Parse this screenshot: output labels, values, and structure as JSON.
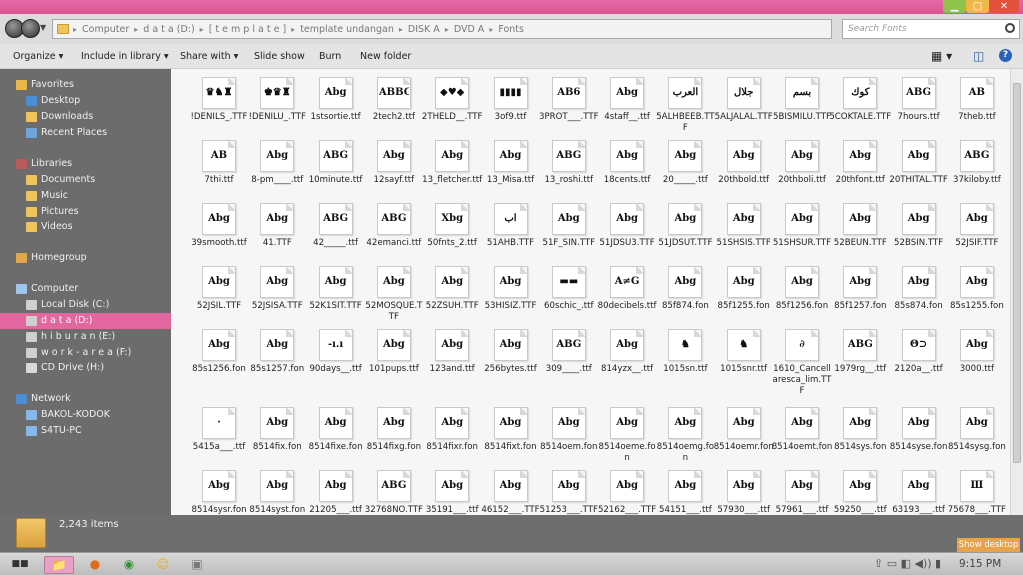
{
  "window": {
    "minimize": "▁",
    "maximize": "□",
    "close": "✕"
  },
  "address": {
    "segments": [
      "Computer",
      "d a t a (D:)",
      "[ t e m p l a t e ]",
      "template undangan",
      "DISK A",
      "DVD A",
      "Fonts"
    ],
    "search_placeholder": "Search Fonts"
  },
  "toolbar": {
    "organize": "Organize",
    "include": "Include in library",
    "share": "Share with",
    "slideshow": "Slide show",
    "burn": "Burn",
    "newfolder": "New folder"
  },
  "nav": [
    {
      "label": "Favorites",
      "icon": "star-icon",
      "kind": "header"
    },
    {
      "label": "Desktop",
      "icon": "desktop-icon"
    },
    {
      "label": "Downloads",
      "icon": "folder-icon"
    },
    {
      "label": "Recent Places",
      "icon": "recent-icon"
    },
    {
      "label": "Libraries",
      "icon": "libraries-icon",
      "kind": "header"
    },
    {
      "label": "Documents",
      "icon": "folder-icon"
    },
    {
      "label": "Music",
      "icon": "folder-icon"
    },
    {
      "label": "Pictures",
      "icon": "folder-icon"
    },
    {
      "label": "Videos",
      "icon": "folder-icon"
    },
    {
      "label": "Homegroup",
      "icon": "homegroup-icon",
      "kind": "header"
    },
    {
      "label": "Computer",
      "icon": "computer-icon",
      "kind": "header"
    },
    {
      "label": "Local Disk (C:)",
      "icon": "drive-icon"
    },
    {
      "label": "d a t a (D:)",
      "icon": "drive-icon",
      "selected": true
    },
    {
      "label": "h i b u r a n (E:)",
      "icon": "drive-icon"
    },
    {
      "label": "w o r k - a r e a (F:)",
      "icon": "drive-icon"
    },
    {
      "label": "CD Drive (H:)",
      "icon": "cd-icon"
    },
    {
      "label": "Network",
      "icon": "network-icon",
      "kind": "header"
    },
    {
      "label": "BAKOL-KODOK",
      "icon": "pc-icon"
    },
    {
      "label": "S4TU-PC",
      "icon": "pc-icon"
    }
  ],
  "files": [
    {
      "name": "!DENILS_.TTF",
      "g": "♛♞♜"
    },
    {
      "name": "!DENILU_.TTF",
      "g": "♚♛♜"
    },
    {
      "name": "1stsortie.ttf",
      "g": "Abg"
    },
    {
      "name": "2tech2.ttf",
      "g": "ABBG"
    },
    {
      "name": "2THELD__.TTF",
      "g": "◆♥◆"
    },
    {
      "name": "3of9.ttf",
      "g": "▮▮▮▮"
    },
    {
      "name": "3PROT___.TTF",
      "g": "AB6"
    },
    {
      "name": "4staff__.ttf",
      "g": "Abg"
    },
    {
      "name": "5ALHBEEB.TTF",
      "g": "ﺍﻟﻌﺮﺏ"
    },
    {
      "name": "5ALJALAL.TTF",
      "g": "ﺟﻼﻝ"
    },
    {
      "name": "5BISMILU.TTF",
      "g": "ﺑﺴﻢ"
    },
    {
      "name": "5COKTALE.TTF",
      "g": "ﻛﻮﻙ"
    },
    {
      "name": "7hours.ttf",
      "g": "ABG"
    },
    {
      "name": "7theb.ttf",
      "g": "AB"
    },
    {
      "name": "7thi.ttf",
      "g": "AB"
    },
    {
      "name": "8-pm____.ttf",
      "g": "Abg"
    },
    {
      "name": "10minute.ttf",
      "g": "ABG"
    },
    {
      "name": "12sayf.ttf",
      "g": "Abg"
    },
    {
      "name": "13_fletcher.ttf",
      "g": "Abg"
    },
    {
      "name": "13_Misa.ttf",
      "g": "Abg"
    },
    {
      "name": "13_roshi.ttf",
      "g": "ABG"
    },
    {
      "name": "18cents.ttf",
      "g": "Abg"
    },
    {
      "name": "20_____.ttf",
      "g": "Abg"
    },
    {
      "name": "20thbold.ttf",
      "g": "Abg"
    },
    {
      "name": "20thboli.ttf",
      "g": "Abg"
    },
    {
      "name": "20thfont.ttf",
      "g": "Abg"
    },
    {
      "name": "20THITAL.TTF",
      "g": "Abg"
    },
    {
      "name": "37kiloby.ttf",
      "g": "ABG"
    },
    {
      "name": "39smooth.ttf",
      "g": "Abg"
    },
    {
      "name": "41.TTF",
      "g": "Abg"
    },
    {
      "name": "42_____.ttf",
      "g": "ABG"
    },
    {
      "name": "42emanci.ttf",
      "g": "ABG"
    },
    {
      "name": "50fnts_2.ttf",
      "g": "Xbg"
    },
    {
      "name": "51AHB.TTF",
      "g": "ﺍﺏ"
    },
    {
      "name": "51F_SIN.TTF",
      "g": "Abg"
    },
    {
      "name": "51JDSU3.TTF",
      "g": "Abg"
    },
    {
      "name": "51JDSUT.TTF",
      "g": "Abg"
    },
    {
      "name": "51SHSIS.TTF",
      "g": "Abg"
    },
    {
      "name": "51SHSUR.TTF",
      "g": "Abg"
    },
    {
      "name": "52BEUN.TTF",
      "g": "Abg"
    },
    {
      "name": "52BSIN.TTF",
      "g": "Abg"
    },
    {
      "name": "52JSIF.TTF",
      "g": "Abg"
    },
    {
      "name": "52JSIL.TTF",
      "g": "Abg"
    },
    {
      "name": "52JSISA.TTF",
      "g": "Abg"
    },
    {
      "name": "52K1SIT.TTF",
      "g": "Abg"
    },
    {
      "name": "52MOSQUE.TTF",
      "g": "Abg"
    },
    {
      "name": "52ZSUH.TTF",
      "g": "Abg"
    },
    {
      "name": "53HISIZ.TTF",
      "g": "Abg"
    },
    {
      "name": "60schic_.ttf",
      "g": "▬▬"
    },
    {
      "name": "80decibels.ttf",
      "g": "A≠G"
    },
    {
      "name": "85f874.fon",
      "g": "Abg"
    },
    {
      "name": "85f1255.fon",
      "g": "Abg"
    },
    {
      "name": "85f1256.fon",
      "g": "Abg"
    },
    {
      "name": "85f1257.fon",
      "g": "Abg"
    },
    {
      "name": "85s874.fon",
      "g": "Abg"
    },
    {
      "name": "85s1255.fon",
      "g": "Abg"
    },
    {
      "name": "85s1256.fon",
      "g": "Abg"
    },
    {
      "name": "85s1257.fon",
      "g": "Abg"
    },
    {
      "name": "90days__.ttf",
      "g": "-ı.ı"
    },
    {
      "name": "101pups.ttf",
      "g": "Abg"
    },
    {
      "name": "123and.ttf",
      "g": "Abg"
    },
    {
      "name": "256bytes.ttf",
      "g": "Abg"
    },
    {
      "name": "309____.ttf",
      "g": "ABG"
    },
    {
      "name": "814yzx__.ttf",
      "g": "Abg"
    },
    {
      "name": "1015sn.ttf",
      "g": "♞"
    },
    {
      "name": "1015snr.ttf",
      "g": "♞"
    },
    {
      "name": "1610_Cancellaresca_lim.TTF",
      "g": "∂"
    },
    {
      "name": "1979rg__.ttf",
      "g": "ABG"
    },
    {
      "name": "2120a__.ttf",
      "g": "Θ⊃"
    },
    {
      "name": "3000.ttf",
      "g": "Abg"
    },
    {
      "name": "5415a___.ttf",
      "g": "·"
    },
    {
      "name": "8514fix.fon",
      "g": "Abg"
    },
    {
      "name": "8514fixe.fon",
      "g": "Abg"
    },
    {
      "name": "8514fixg.fon",
      "g": "Abg"
    },
    {
      "name": "8514fixr.fon",
      "g": "Abg"
    },
    {
      "name": "8514fixt.fon",
      "g": "Abg"
    },
    {
      "name": "8514oem.fon",
      "g": "Abg"
    },
    {
      "name": "8514oeme.fon",
      "g": "Abg"
    },
    {
      "name": "8514oemg.fon",
      "g": "Abg"
    },
    {
      "name": "8514oemr.fon",
      "g": "Abg"
    },
    {
      "name": "8514oemt.fon",
      "g": "Abg"
    },
    {
      "name": "8514sys.fon",
      "g": "Abg"
    },
    {
      "name": "8514syse.fon",
      "g": "Abg"
    },
    {
      "name": "8514sysg.fon",
      "g": "Abg"
    },
    {
      "name": "8514sysr.fon",
      "g": "Abg"
    },
    {
      "name": "8514syst.fon",
      "g": "Abg"
    },
    {
      "name": "21205___.ttf",
      "g": "Abg"
    },
    {
      "name": "32768NO.TTF",
      "g": "ABG"
    },
    {
      "name": "35191___.ttf",
      "g": "Abg"
    },
    {
      "name": "46152___.TTF",
      "g": "Abg"
    },
    {
      "name": "51253___.TTF",
      "g": "Abg"
    },
    {
      "name": "52162___.TTF",
      "g": "Abg"
    },
    {
      "name": "54151___.ttf",
      "g": "Abg"
    },
    {
      "name": "57930___.ttf",
      "g": "Abg"
    },
    {
      "name": "57961___.ttf",
      "g": "Abg"
    },
    {
      "name": "59250___.ttf",
      "g": "Abg"
    },
    {
      "name": "63193___.ttf",
      "g": "Abg"
    },
    {
      "name": "75678___.TTF",
      "g": "Ш"
    }
  ],
  "details": {
    "count": "2,243 items"
  },
  "showdesktop": "Show desktop",
  "clock": "9:15 PM",
  "colors": {
    "accent": "#e2679f",
    "titlebar": "#de5e9a",
    "nav_bg": "#6c6c6c"
  }
}
